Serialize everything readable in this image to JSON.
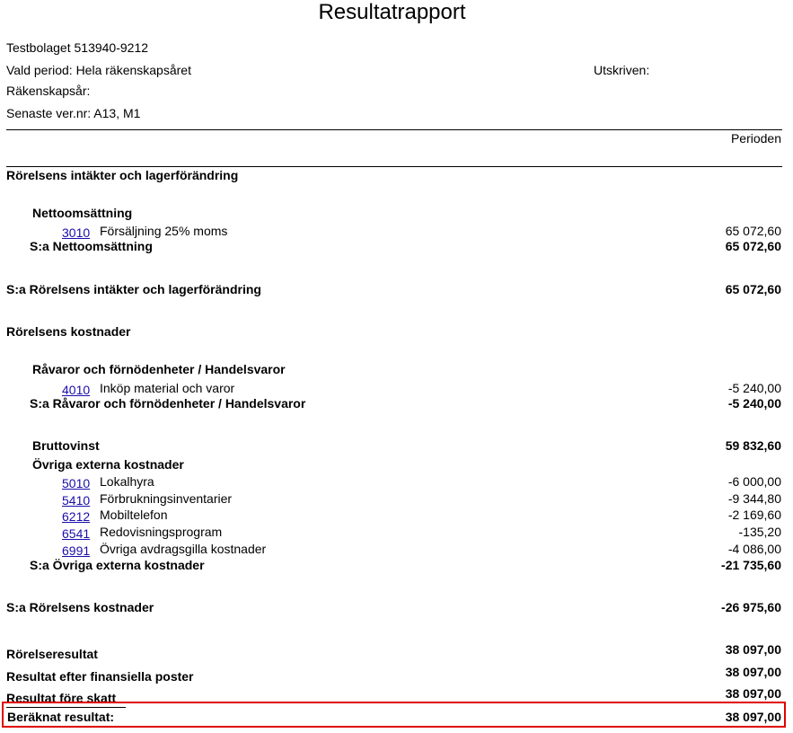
{
  "title": "Resultatrapport",
  "meta": {
    "company": "Testbolaget 513940-9212",
    "period": "Vald period: Hela räkenskapsåret",
    "printed": "Utskriven:",
    "fiscal_year": "Räkenskapsår:",
    "last_voucher": "Senaste ver.nr: A13, M1"
  },
  "column_header": "Perioden",
  "report": {
    "s1_title": "Rörelsens intäkter och lagerförändring",
    "net_title": "Nettoomsättning",
    "acc_3010": {
      "number": "3010",
      "name": "Försäljning 25% moms",
      "amount": "65 072,60"
    },
    "net_sum": {
      "label": "S:a Nettoomsättning",
      "amount": "65 072,60"
    },
    "s1_sum": {
      "label": "S:a Rörelsens intäkter och lagerförändring",
      "amount": "65 072,60"
    },
    "s2_title": "Rörelsens kostnader",
    "raw_title": "Råvaror och förnödenheter / Handelsvaror",
    "acc_4010": {
      "number": "4010",
      "name": "Inköp material och varor",
      "amount": "-5 240,00"
    },
    "raw_sum": {
      "label": "S:a Råvaror och förnödenheter / Handelsvaror",
      "amount": "-5 240,00"
    },
    "gross": {
      "label": "Bruttovinst",
      "amount": "59 832,60"
    },
    "ext_title": "Övriga externa kostnader",
    "ext_accounts": [
      {
        "number": "5010",
        "name": "Lokalhyra",
        "amount": "-6 000,00"
      },
      {
        "number": "5410",
        "name": "Förbrukningsinventarier",
        "amount": "-9 344,80"
      },
      {
        "number": "6212",
        "name": "Mobiltelefon",
        "amount": "-2 169,60"
      },
      {
        "number": "6541",
        "name": "Redovisningsprogram",
        "amount": "-135,20"
      },
      {
        "number": "6991",
        "name": "Övriga avdragsgilla kostnader",
        "amount": "-4 086,00"
      }
    ],
    "ext_sum": {
      "label": "S:a Övriga externa kostnader",
      "amount": "-21 735,60"
    },
    "s2_sum": {
      "label": "S:a Rörelsens kostnader",
      "amount": "-26 975,60"
    },
    "operating": {
      "label": "Rörelseresultat",
      "amount": "38 097,00"
    },
    "after_fin": {
      "label": "Resultat efter finansiella poster",
      "amount": "38 097,00"
    },
    "before_tax": {
      "label": "Resultat före skatt",
      "amount": "38 097,00"
    },
    "calculated": {
      "label": "Beräknat resultat:",
      "amount": "38 097,00"
    }
  }
}
